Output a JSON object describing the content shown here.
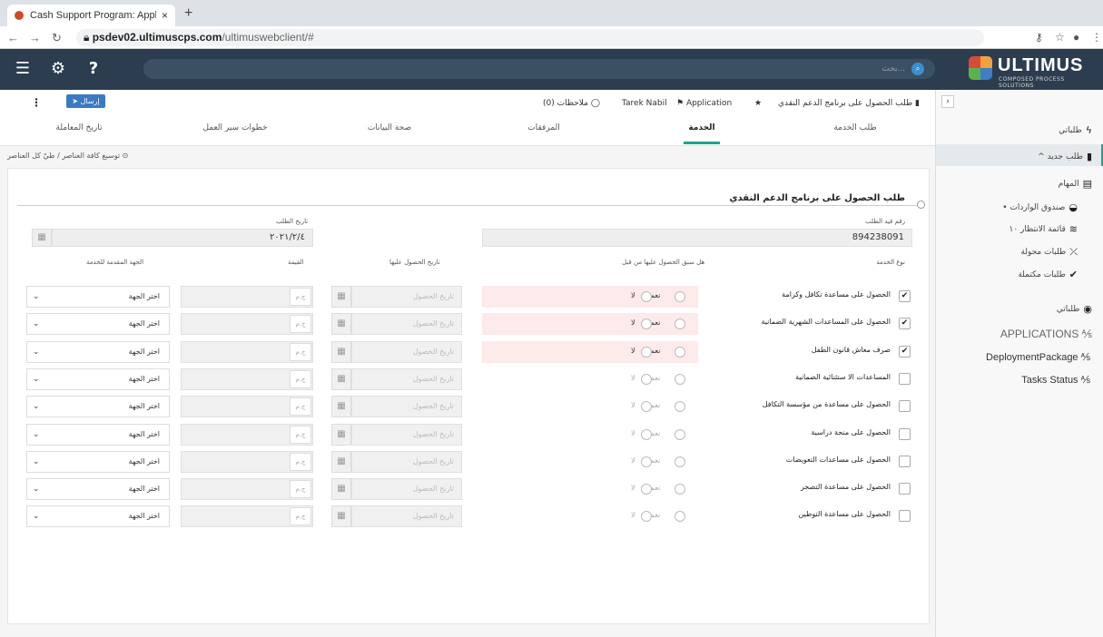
{
  "browser": {
    "tab_title": "Cash Support Program: Applic",
    "tab_close": "×",
    "new_tab": "+",
    "url_host": "psdev02.ultimuscps.com",
    "url_path": "/ultimuswebclient/#"
  },
  "appbar": {
    "search_placeholder": "بحث...",
    "logo_word": "ULTIMUS",
    "logo_sub": "COMPOSED PROCESS SOLUTIONS"
  },
  "sidebar": {
    "my_requests": "طلباتي",
    "new_request": "طلب جديد ^",
    "tasks": "المهام",
    "inbox": "صندوق الواردات •",
    "waiting": "قائمة الانتظار ١٠",
    "transferred": "طلبات محولة",
    "completed": "طلبات مكتملة",
    "my_requests2": "طلباتي",
    "applications": "APPLICATIONS",
    "app_links": [
      "DeploymentPackage",
      "Tasks Status"
    ]
  },
  "header": {
    "send": "إرسال",
    "request_name": "طلب الحصول على برنامج الدعم النقدي",
    "application": "Application",
    "user": "Tarek Nabil",
    "notes": "ملاحظات (0)"
  },
  "tabs": [
    {
      "label": "طلب الخدمة",
      "active": false
    },
    {
      "label": "الخدمة",
      "active": true
    },
    {
      "label": "المرفقات",
      "active": false
    },
    {
      "label": "صحة البيانات",
      "active": false
    },
    {
      "label": "خطوات سير العمل",
      "active": false
    },
    {
      "label": "تاريخ المعاملة",
      "active": false
    }
  ],
  "breadcrumb": "توسيع كافة العناصر / طيّ كل العناصر",
  "form": {
    "title": "طلب الحصول على برنامج الدعم النقدي",
    "request_no_label": "رقم قيد الطلب",
    "request_no": "894238091",
    "request_date_label": "تاريخ الطلب",
    "request_date": "٢٠٢١/٢/٤",
    "columns": {
      "service_type": "نوع الخدمة",
      "received_before": "هل سبق الحصول عليها من قبل",
      "received_date": "تاريخ الحصول عليها",
      "value": "القيمة",
      "provider": "الجهة المقدمة للخدمة"
    },
    "yes": "نعم",
    "no": "لا",
    "date_placeholder": "تاريخ الحصول",
    "currency": "ج.م",
    "provider_placeholder": "اختر الجهة",
    "rows": [
      {
        "service": "الحصول على مساعدة تكافل وكرامة",
        "checked": true
      },
      {
        "service": "الحصول على المساعدات الشهرية الضمانية",
        "checked": true
      },
      {
        "service": "صرف معاش قانون الطفل",
        "checked": true
      },
      {
        "service": "المساعدات الا ستثنائية الضمانية",
        "checked": false
      },
      {
        "service": "الحصول على مساعدة من مؤسسة التكافل",
        "checked": false
      },
      {
        "service": "الحصول على منحة دراسية",
        "checked": false
      },
      {
        "service": "الحصول على مساعدات التعويضات",
        "checked": false
      },
      {
        "service": "الحصول على مساعدة التصحر",
        "checked": false
      },
      {
        "service": "الحصول على مساعدة التوطين",
        "checked": false
      }
    ]
  }
}
